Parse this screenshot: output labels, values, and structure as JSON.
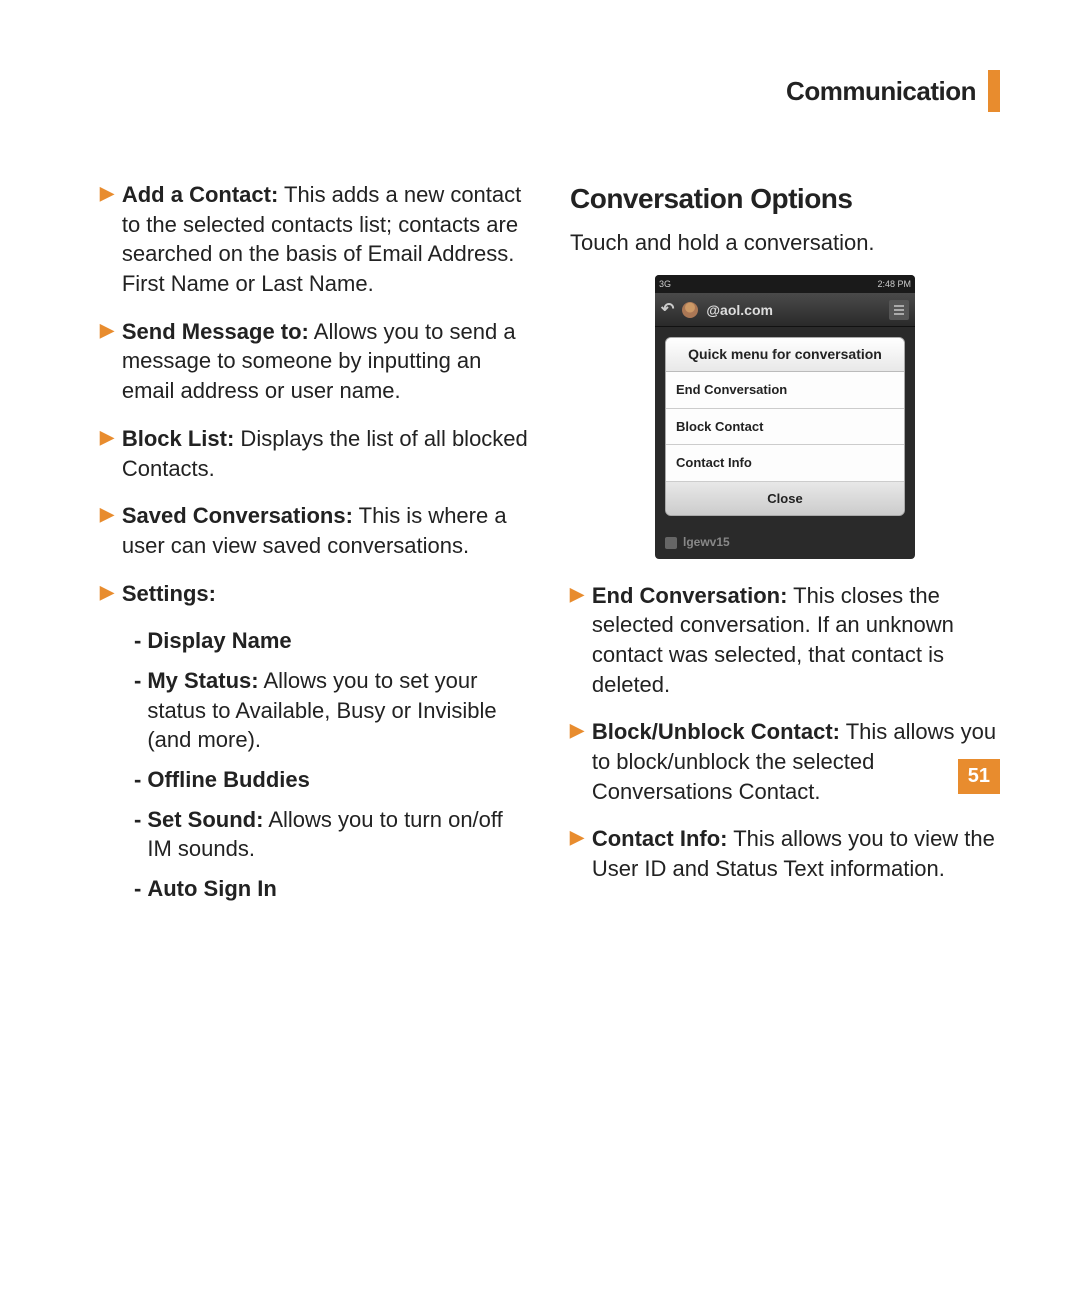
{
  "header": {
    "title": "Communication"
  },
  "left": {
    "items": [
      {
        "bold": "Add a Contact:",
        "text": " This adds a new contact to the selected contacts list; contacts are searched on the basis of Email Address. First Name or Last Name."
      },
      {
        "bold": "Send Message to:",
        "text": " Allows you to send a message to someone by inputting an email address or user name."
      },
      {
        "bold": "Block List:",
        "text": " Displays the list of all blocked Contacts."
      },
      {
        "bold": "Saved Conversations:",
        "text": " This is where a user can view saved conversations."
      },
      {
        "bold": "Settings:",
        "text": ""
      }
    ],
    "subs": [
      {
        "bold": "Display Name",
        "text": ""
      },
      {
        "bold": "My Status:",
        "text": " Allows you to set your status to Available, Busy or Invisible (and more)."
      },
      {
        "bold": "Offline Buddies",
        "text": ""
      },
      {
        "bold": "Set Sound:",
        "text": " Allows you to turn on/off IM sounds."
      },
      {
        "bold": "Auto Sign In",
        "text": ""
      }
    ]
  },
  "right": {
    "heading": "Conversation Options",
    "sub": "Touch and hold a conversation.",
    "items": [
      {
        "bold": "End Conversation:",
        "text": " This closes the selected conversation. If an unknown contact was selected, that contact is deleted."
      },
      {
        "bold": "Block/Unblock Contact:",
        "text": " This allows you to block/unblock the selected Conversations Contact."
      },
      {
        "bold": "Contact Info:",
        "text": " This allows you to view the User ID and Status Text information."
      }
    ]
  },
  "phone": {
    "status_left": "3G",
    "status_right": "2:48 PM",
    "title": "@aol.com",
    "popup_title": "Quick menu for conversation",
    "menu_items": [
      "End Conversation",
      "Block Contact",
      "Contact Info"
    ],
    "close": "Close",
    "contact": "lgewv15"
  },
  "page_number": "51"
}
